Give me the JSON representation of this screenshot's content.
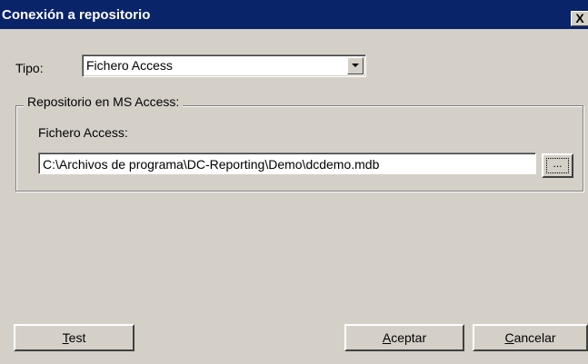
{
  "window": {
    "title": "Conexión a repositorio",
    "close_label": "X"
  },
  "form": {
    "tipo_label": "Tipo:",
    "tipo_value": "Fichero Access",
    "group_title": "Repositorio en MS Access:",
    "file_label": "Fichero Access:",
    "file_path": "C:\\Archivos de programa\\DC-Reporting\\Demo\\dcdemo.mdb",
    "browse_label": "..."
  },
  "buttons": {
    "test": {
      "mnemonic": "T",
      "rest": "est"
    },
    "accept": {
      "mnemonic": "A",
      "rest": "ceptar"
    },
    "cancel": {
      "mnemonic": "C",
      "rest": "ancelar"
    }
  }
}
